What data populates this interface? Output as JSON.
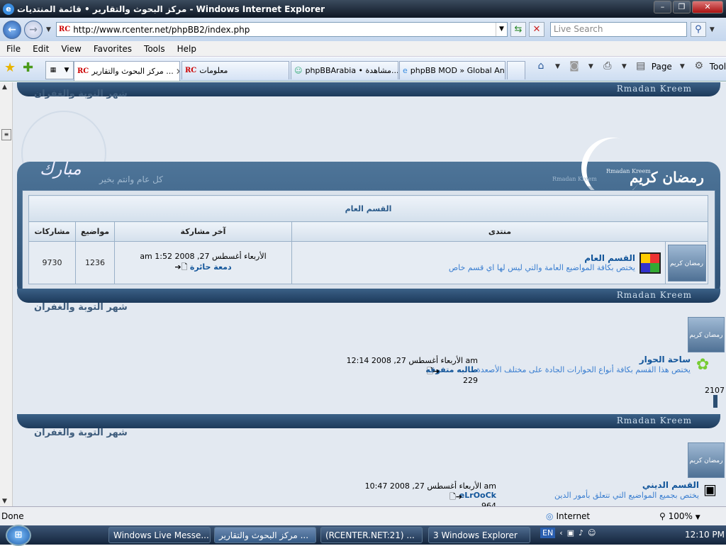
{
  "window": {
    "title": "مركز البحوث والتقارير • قائمة المنتديات - Windows Internet Explorer"
  },
  "address": {
    "url": "http://www.rcenter.net/phpBB2/index.php",
    "search_placeholder": "Live Search"
  },
  "menu": [
    "File",
    "Edit",
    "View",
    "Favorites",
    "Tools",
    "Help"
  ],
  "tabs": [
    {
      "label": "مركز البحوث والتقارير ...",
      "active": true
    },
    {
      "label": "معلومات",
      "active": false
    },
    {
      "label": "phpBBArabia • مشاهدة...",
      "active": false
    },
    {
      "label": "phpBB MOD » Global An...",
      "active": false
    }
  ],
  "commands": {
    "page": "Page",
    "tools": "Tools"
  },
  "page": {
    "section_title": "شهر التوبة والغفران",
    "rk_text": "Rmadan Kreem",
    "greeting": "كل عام وانتم بخير",
    "ramadan_title": "رمضان كريم",
    "ramadan_small": "Rmadan Kreem",
    "calligraphy": "مبارك",
    "table": {
      "caption": "القسم العام",
      "headers": {
        "forum": "منتدى",
        "last": "آخر مشاركة",
        "topics": "مواضيع",
        "posts": "مشاركات"
      },
      "rows": [
        {
          "icon_label": "رمضان كريم",
          "name": "القسم العام",
          "desc": "يختص بكافة المواضيع العامة والتي ليس لها اي قسم خاص",
          "last_date": "الأربعاء أغسطس 27, 2008 1:52 am",
          "last_user": "دمعة حائرة",
          "topics": "1236",
          "posts": "9730"
        }
      ]
    },
    "second": {
      "name": "ساحة الحوار",
      "desc": "يختص هذا القسم بكافة أنواع الحوارات الجادة على مختلف الأصعدة",
      "last_date": "الأربعاء أغسطس 27, 2008 12:14 am",
      "last_user": "طالبه متفوقه",
      "topics": "229",
      "posts": "2107"
    },
    "third": {
      "name": "القسم الديني",
      "desc": "يختص بجميع المواضيع التي تتعلق بأمور الدين",
      "last_date": "الأربعاء أغسطس 27, 2008 10:47 am",
      "last_user": "eLrOoCk",
      "topics": "964"
    }
  },
  "status": {
    "text": "Done",
    "zone": "Internet",
    "zoom": "100%"
  },
  "taskbar": {
    "items": [
      "Windows Live Messe...",
      "مركز البحوث والتقارير ...",
      "(RCENTER.NET:21) ...",
      "3 Windows Explorer"
    ],
    "lang": "EN",
    "clock": "12:10 PM"
  },
  "colors": {
    "accent": "#12559a",
    "panel": "#2c4e72",
    "bg": "#e3e9f1"
  }
}
